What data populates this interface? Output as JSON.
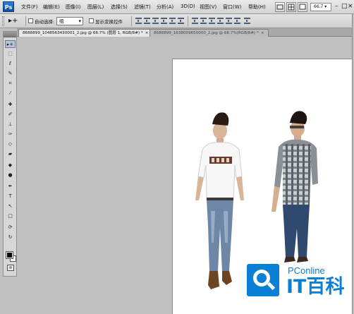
{
  "menubar": {
    "logo": "Ps",
    "items": [
      "文件(F)",
      "编辑(E)",
      "图像(I)",
      "图层(L)",
      "选择(S)",
      "滤镜(T)",
      "分析(A)",
      "3D(D)",
      "视图(V)",
      "窗口(W)",
      "帮助(H)"
    ],
    "zoom": "66.7",
    "zoom_arrow": "▾",
    "window_controls": [
      "–",
      "□",
      "×"
    ]
  },
  "options": {
    "tool_glyph": "▸+",
    "auto_select_label": "自动选择:",
    "auto_select_value": "组",
    "transform_label": "显示变换控件"
  },
  "tabs": [
    {
      "label": "8688899_1048563430001_2.jpg @ 66.7% (图层 1, RGB/8#) *",
      "close": "×"
    },
    {
      "label": "8688899_1638009650000_2.jpg @ 66.7%(RGB/8#) *",
      "close": "×"
    }
  ],
  "tools": [
    {
      "name": "move-tool",
      "glyph": "▸+"
    },
    {
      "name": "marquee-tool",
      "glyph": "⬚"
    },
    {
      "name": "lasso-tool",
      "glyph": "ℓ"
    },
    {
      "name": "quick-select-tool",
      "glyph": "✎"
    },
    {
      "name": "crop-tool",
      "glyph": "⌗"
    },
    {
      "name": "eyedropper-tool",
      "glyph": "⁄"
    },
    {
      "name": "healing-brush-tool",
      "glyph": "✚"
    },
    {
      "name": "brush-tool",
      "glyph": "✐"
    },
    {
      "name": "clone-stamp-tool",
      "glyph": "⊥"
    },
    {
      "name": "history-brush-tool",
      "glyph": "✑"
    },
    {
      "name": "eraser-tool",
      "glyph": "◇"
    },
    {
      "name": "gradient-tool",
      "glyph": "▰"
    },
    {
      "name": "blur-tool",
      "glyph": "◆"
    },
    {
      "name": "dodge-tool",
      "glyph": "●"
    },
    {
      "name": "pen-tool",
      "glyph": "✒"
    },
    {
      "name": "type-tool",
      "glyph": "T"
    },
    {
      "name": "path-select-tool",
      "glyph": "↖"
    },
    {
      "name": "shape-tool",
      "glyph": "□"
    },
    {
      "name": "3d-rotate-tool",
      "glyph": "⟳"
    },
    {
      "name": "3d-orbit-tool",
      "glyph": "↻"
    },
    {
      "name": "hand-tool",
      "glyph": "✋"
    },
    {
      "name": "zoom-tool",
      "glyph": "⌕"
    }
  ],
  "watermark": {
    "brand": "PConline",
    "site": "IT百科"
  }
}
